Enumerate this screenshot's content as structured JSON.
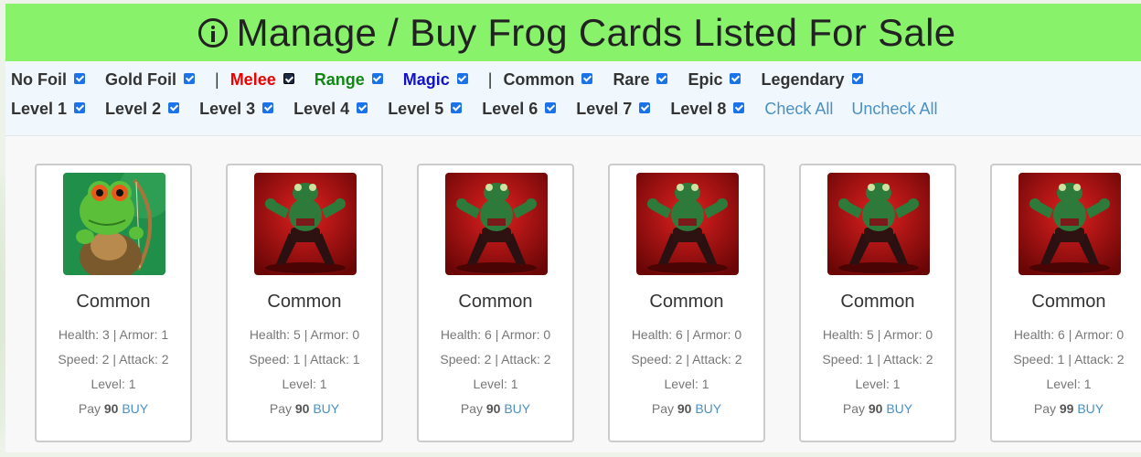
{
  "header": {
    "title": "Manage / Buy Frog Cards Listed For Sale",
    "icon": "info-circle-icon"
  },
  "filters": {
    "row1": [
      {
        "label": "No Foil"
      },
      {
        "label": "Gold Foil"
      },
      {
        "label": "Melee",
        "color": "#ee0000"
      },
      {
        "label": "Range",
        "color": "#118811"
      },
      {
        "label": "Magic",
        "color": "#1212cc"
      },
      {
        "label": "Common"
      },
      {
        "label": "Rare"
      },
      {
        "label": "Epic"
      },
      {
        "label": "Legendary"
      }
    ],
    "separator": "|",
    "row2": [
      {
        "label": "Level 1"
      },
      {
        "label": "Level 2"
      },
      {
        "label": "Level 3"
      },
      {
        "label": "Level 4"
      },
      {
        "label": "Level 5"
      },
      {
        "label": "Level 6"
      },
      {
        "label": "Level 7"
      },
      {
        "label": "Level 8"
      }
    ],
    "check_all": "Check All",
    "uncheck_all": "Uncheck All"
  },
  "cards": [
    {
      "image": "archer-frog",
      "rarity": "Common",
      "health_armor": "Health: 3 | Armor: 1",
      "speed_attack": "Speed: 2 | Attack: 2",
      "level": "Level: 1",
      "pay_label": "Pay",
      "price": "90",
      "buy": "BUY"
    },
    {
      "image": "fighter-frog",
      "rarity": "Common",
      "health_armor": "Health: 5 | Armor: 0",
      "speed_attack": "Speed: 1 | Attack: 1",
      "level": "Level: 1",
      "pay_label": "Pay",
      "price": "90",
      "buy": "BUY"
    },
    {
      "image": "fighter-frog",
      "rarity": "Common",
      "health_armor": "Health: 6 | Armor: 0",
      "speed_attack": "Speed: 2 | Attack: 2",
      "level": "Level: 1",
      "pay_label": "Pay",
      "price": "90",
      "buy": "BUY"
    },
    {
      "image": "fighter-frog",
      "rarity": "Common",
      "health_armor": "Health: 6 | Armor: 0",
      "speed_attack": "Speed: 2 | Attack: 2",
      "level": "Level: 1",
      "pay_label": "Pay",
      "price": "90",
      "buy": "BUY"
    },
    {
      "image": "fighter-frog",
      "rarity": "Common",
      "health_armor": "Health: 5 | Armor: 0",
      "speed_attack": "Speed: 1 | Attack: 2",
      "level": "Level: 1",
      "pay_label": "Pay",
      "price": "90",
      "buy": "BUY"
    },
    {
      "image": "fighter-frog",
      "rarity": "Common",
      "health_armor": "Health: 6 | Armor: 0",
      "speed_attack": "Speed: 1 | Attack: 2",
      "level": "Level: 1",
      "pay_label": "Pay",
      "price": "99",
      "buy": "BUY"
    }
  ],
  "colors": {
    "header_bg": "#88f36a",
    "filter_bg": "#f0f8fd",
    "link": "#4a90c4",
    "checkbox": "#1a73e8"
  }
}
